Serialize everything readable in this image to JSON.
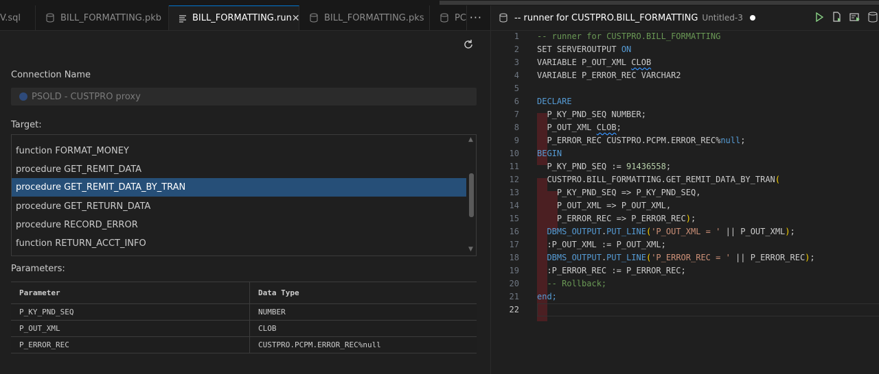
{
  "tabs": [
    {
      "label": "V.sql",
      "icon": "file-icon"
    },
    {
      "label": "BILL_FORMATTING.pkb",
      "icon": "database-icon"
    },
    {
      "label": "BILL_FORMATTING.run",
      "icon": "list-icon",
      "active": true
    },
    {
      "label": "BILL_FORMATTING.pks",
      "icon": "database-icon"
    },
    {
      "label": "PC",
      "icon": "database-icon"
    }
  ],
  "more_label": "···",
  "form": {
    "connection_label": "Connection Name",
    "connection_value": "PSOLD - CUSTPRO proxy",
    "target_label": "Target:",
    "targets": [
      "function FORMAT_MONEY",
      "procedure GET_REMIT_DATA",
      "procedure GET_REMIT_DATA_BY_TRAN",
      "procedure GET_RETURN_DATA",
      "procedure RECORD_ERROR",
      "function RETURN_ACCT_INFO"
    ],
    "selected_target_index": 2,
    "parameters_label": "Parameters:",
    "param_headers": [
      "Parameter",
      "Data Type"
    ],
    "params": [
      {
        "name": "P_KY_PND_SEQ",
        "type": "NUMBER"
      },
      {
        "name": "P_OUT_XML",
        "type": "CLOB"
      },
      {
        "name": "P_ERROR_REC",
        "type": "CUSTPRO.PCPM.ERROR_REC%null"
      }
    ]
  },
  "editor": {
    "title": "-- runner for CUSTPRO.BILL_FORMATTING",
    "subtitle": "Untitled-3",
    "line_numbers": [
      "1",
      "2",
      "3",
      "4",
      "5",
      "6",
      "7",
      "8",
      "9",
      "10",
      "11",
      "12",
      "13",
      "14",
      "15",
      "16",
      "17",
      "18",
      "19",
      "20",
      "21",
      "22"
    ],
    "code": {
      "l1": "-- runner for CUSTPRO.BILL_FORMATTING",
      "l2a": "SET SERVEROUTPUT ",
      "l2b": "ON",
      "l3a": "VARIABLE P_OUT_XML ",
      "l3b": "CLOB",
      "l4": "VARIABLE P_ERROR_REC VARCHAR2",
      "l6": "DECLARE",
      "l7": "  P_KY_PND_SEQ NUMBER;",
      "l8a": "  P_OUT_XML ",
      "l8b": "CLOB",
      "l8c": ";",
      "l9a": "  P_ERROR_REC CUSTPRO.PCPM.ERROR_REC%",
      "l9b": "null",
      "l9c": ";",
      "l10": "BEGIN",
      "l11a": "  P_KY_PND_SEQ := ",
      "l11b": "91436558",
      "l11c": ";",
      "l12a": "  CUSTPRO.BILL_FORMATTING.GET_REMIT_DATA_BY_TRAN",
      "l12b": "(",
      "l13": "    P_KY_PND_SEQ => P_KY_PND_SEQ,",
      "l14": "    P_OUT_XML => P_OUT_XML,",
      "l15a": "    P_ERROR_REC => P_ERROR_REC",
      "l15b": ")",
      "l15c": ";",
      "l16a": "  ",
      "l16b": "DBMS_OUTPUT",
      "l16c": ".",
      "l16d": "PUT_LINE",
      "l16e": "(",
      "l16f": "'P_OUT_XML = '",
      "l16g": " || P_OUT_XML",
      "l16h": ")",
      "l16i": ";",
      "l17": "  :P_OUT_XML := P_OUT_XML;",
      "l18a": "  ",
      "l18b": "DBMS_OUTPUT",
      "l18c": ".",
      "l18d": "PUT_LINE",
      "l18e": "(",
      "l18f": "'P_ERROR_REC = '",
      "l18g": " || P_ERROR_REC",
      "l18h": ")",
      "l18i": ";",
      "l19": "  :P_ERROR_REC := P_ERROR_REC;",
      "l20": "  -- Rollback;",
      "l21": "end;"
    }
  },
  "colors": {
    "accent": "#0078d4",
    "selection": "#264f78",
    "keyword": "#569cd6",
    "comment": "#6a9955",
    "string": "#ce9178",
    "number": "#b5cea8",
    "run": "#89d185"
  }
}
